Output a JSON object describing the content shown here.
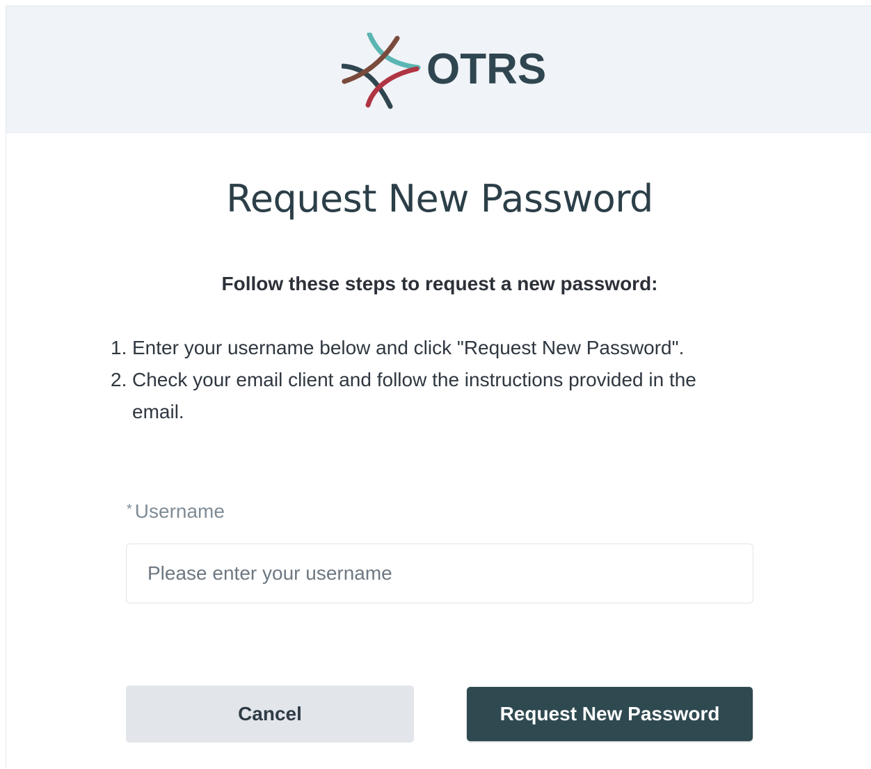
{
  "brand": {
    "name": "OTRS",
    "colors": {
      "teal": "#5bb6b3",
      "dark": "#2f4650",
      "brown": "#7a4a3c",
      "red": "#b03442"
    }
  },
  "page": {
    "title": "Request New Password",
    "subtitle": "Follow these steps to request a new password:",
    "steps": [
      {
        "num": "1.",
        "text": "Enter your username below and click \"Request New Password\"."
      },
      {
        "num": "2.",
        "text": "Check your email client and follow the instructions provided in the email."
      }
    ]
  },
  "form": {
    "username": {
      "required_marker": "*",
      "label": "Username",
      "placeholder": "Please enter your username",
      "value": ""
    }
  },
  "actions": {
    "cancel_label": "Cancel",
    "submit_label": "Request New Password"
  }
}
